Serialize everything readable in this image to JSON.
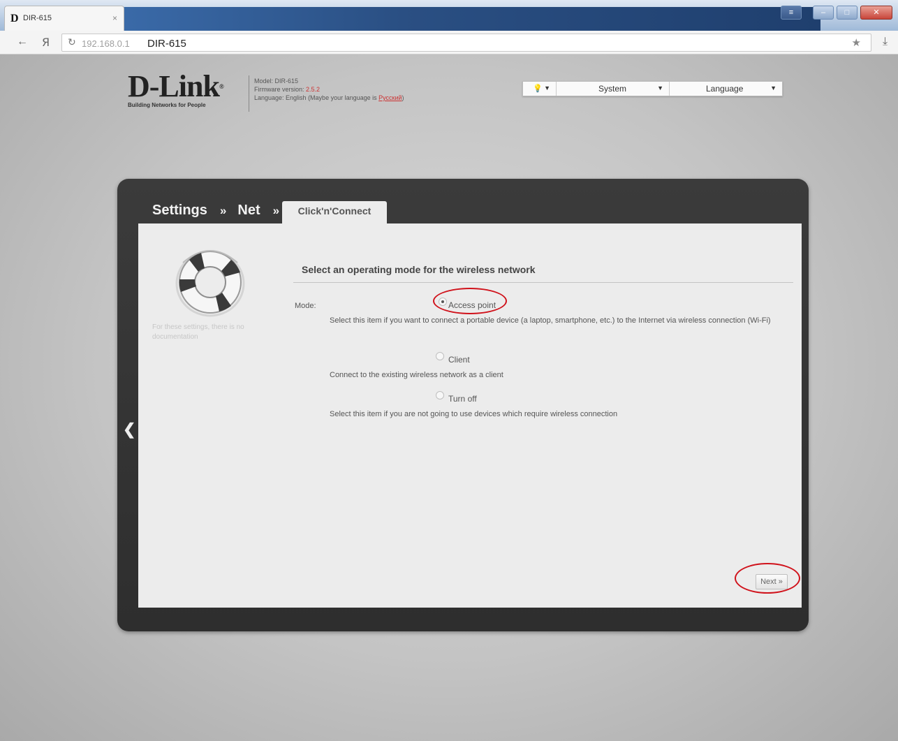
{
  "browser": {
    "tab_icon": "D",
    "tab_title": "DIR-615",
    "tab_close": "×",
    "url_host": "192.168.0.1",
    "url_title": "DIR-615"
  },
  "header": {
    "brand": "D-Link",
    "brand_reg": "®",
    "tagline": "Building Networks for People",
    "model_label": "Model: DIR-615",
    "firmware_label": "Firmware version:",
    "firmware_value": "2.5.2",
    "language_label": "Language: English (Maybe your language is",
    "language_link": "Русский",
    "language_close": ")"
  },
  "topmenu": {
    "item1": "💡",
    "item2": "System",
    "item3": "Language"
  },
  "breadcrumb": {
    "settings": "Settings",
    "net": "Net",
    "sep": "»"
  },
  "active_tab": "Click'n'Connect",
  "sidebar": {
    "no_docs": "For these settings, there is no documentation"
  },
  "form": {
    "title": "Select an operating mode for the wireless network",
    "mode_label": "Mode:",
    "options": [
      {
        "label": "Access point",
        "selected": true,
        "description": "Select this item if you want to connect a portable device (a laptop, smartphone, etc.) to the Internet via wireless connection (Wi-Fi)"
      },
      {
        "label": "Client",
        "selected": false,
        "description": "Connect to the existing wireless network as a client"
      },
      {
        "label": "Turn off",
        "selected": false,
        "description": "Select this item if you are not going to use devices which require wireless connection"
      }
    ],
    "next_label": "Next »"
  },
  "colors": {
    "annotation_red": "#d0121b",
    "frame_dark": "#333333",
    "panel_bg": "#ececec"
  },
  "icons": [
    "back-icon",
    "yandex-icon",
    "reload-icon",
    "star-icon",
    "download-icon",
    "lifebuoy-icon",
    "chevron-left-icon"
  ]
}
